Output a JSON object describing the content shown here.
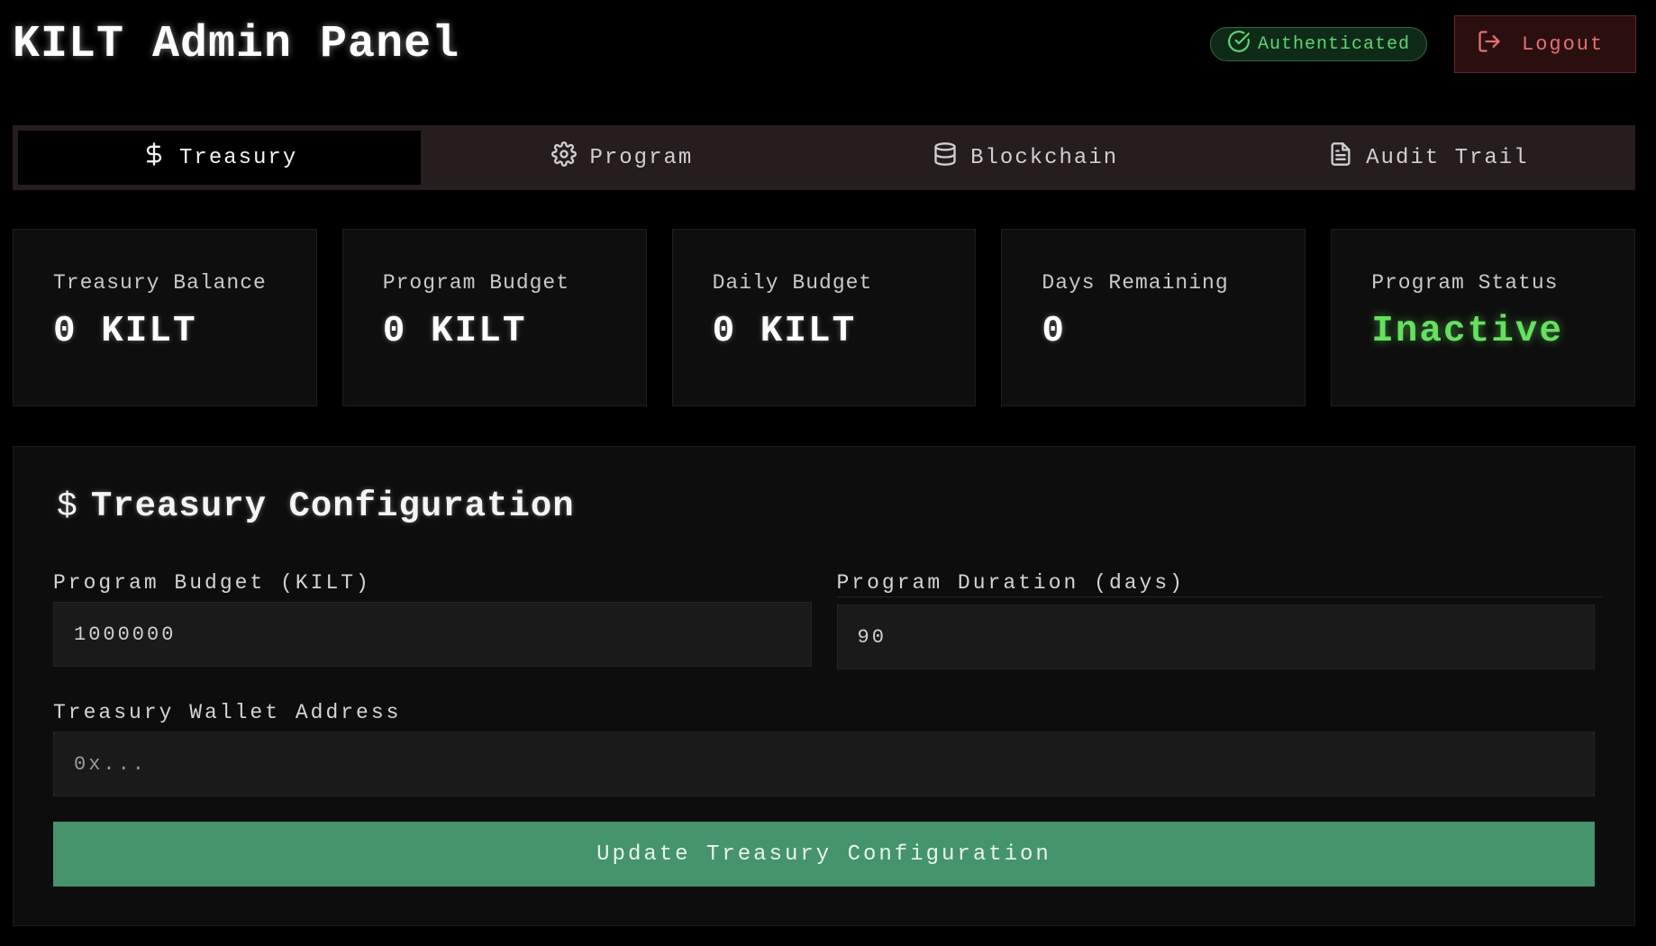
{
  "header": {
    "title": "KILT Admin Panel",
    "auth_status": "Authenticated",
    "logout_label": "Logout"
  },
  "tabs": [
    {
      "label": "Treasury",
      "icon": "dollar-icon",
      "active": true
    },
    {
      "label": "Program",
      "icon": "gear-icon",
      "active": false
    },
    {
      "label": "Blockchain",
      "icon": "database-icon",
      "active": false
    },
    {
      "label": "Audit Trail",
      "icon": "file-text-icon",
      "active": false
    }
  ],
  "stats": [
    {
      "label": "Treasury Balance",
      "value": "0 KILT"
    },
    {
      "label": "Program Budget",
      "value": "0 KILT"
    },
    {
      "label": "Daily Budget",
      "value": "0 KILT"
    },
    {
      "label": "Days Remaining",
      "value": "0"
    },
    {
      "label": "Program Status",
      "value": "Inactive"
    }
  ],
  "config": {
    "icon": "$",
    "title": "Treasury Configuration",
    "program_budget": {
      "label": "Program Budget (KILT)",
      "value": "1000000"
    },
    "program_duration": {
      "label": "Program Duration (days)",
      "value": "90"
    },
    "wallet": {
      "label": "Treasury Wallet Address",
      "placeholder": "0x...",
      "value": ""
    },
    "submit_label": "Update Treasury Configuration"
  },
  "colors": {
    "background": "#000000",
    "accent_green": "#45946b",
    "status_inactive": "#66e05f",
    "auth_green": "#5fd476",
    "logout_red": "#e0726e"
  }
}
